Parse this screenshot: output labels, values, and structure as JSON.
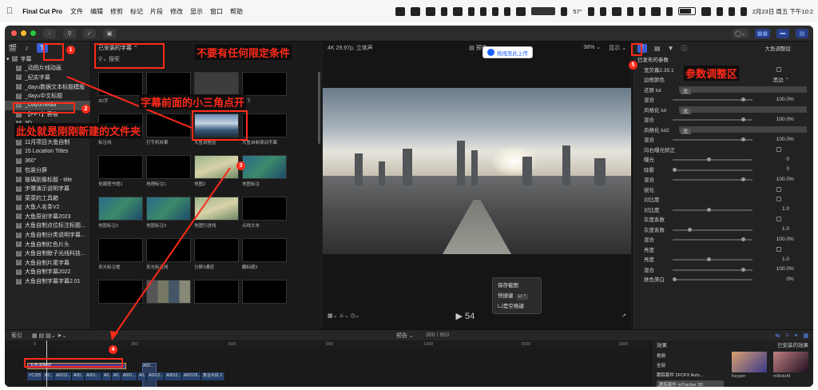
{
  "menubar": {
    "app_name": "Final Cut Pro",
    "items": [
      "文件",
      "编辑",
      "修剪",
      "标记",
      "片段",
      "修改",
      "显示",
      "窗口",
      "帮助"
    ],
    "temperature": "57°",
    "datetime": "2月23日 周五 下午10:2"
  },
  "sidebar": {
    "root_label": "字幕",
    "items": [
      "_动图片线动画",
      "_纪实字幕",
      "_dayu数据文本标题模版",
      "_dayu中文标题",
      "_Dayumedia",
      "【PPT】表格",
      "3D",
      "3D 电影",
      "11月项目大鱼自制",
      "15 Location Titles",
      "360°",
      "包装分屏",
      "玻璃刮像标题 - title",
      "步骤演示说明字幕",
      "菜菜的工具箱",
      "大鱼人名条V2",
      "大鱼原创字幕2023",
      "大鱼自制点位标注标题...",
      "大鱼自制分类说明字幕...",
      "大鱼自制红色片头",
      "大鱼自制鲸子光线科技...",
      "大鱼自制片尾字幕",
      "大鱼自制字幕2022",
      "大鱼自制字幕字幕2.01"
    ]
  },
  "browser": {
    "filter_label": "已安装的字幕 ⌃",
    "search_placeholder": "搜索",
    "cells": [
      {
        "cap": "3D字",
        "style": ""
      },
      {
        "cap": "",
        "style": ""
      },
      {
        "cap": "",
        "style": "lt"
      },
      {
        "cap": "上下",
        "style": ""
      },
      {
        "cap": "标注线",
        "style": ""
      },
      {
        "cap": "打字机效果",
        "style": ""
      },
      {
        "cap": "大鱼调整层",
        "style": "lake"
      },
      {
        "cap": "大鱼自制滚动字幕",
        "style": ""
      },
      {
        "cap": "党建图书馆1",
        "style": ""
      },
      {
        "cap": "地理标注1",
        "style": ""
      },
      {
        "cap": "地图2",
        "style": "aerial"
      },
      {
        "cap": "地图标注",
        "style": "map"
      },
      {
        "cap": "地图标注2",
        "style": "map"
      },
      {
        "cap": "地图标注3",
        "style": "map"
      },
      {
        "cap": "地图行进线",
        "style": "aerial"
      },
      {
        "cap": "点线文本",
        "style": ""
      },
      {
        "cap": "发光标注框",
        "style": ""
      },
      {
        "cap": "发光标注线",
        "style": ""
      },
      {
        "cap": "分屏3通道",
        "style": ""
      },
      {
        "cap": "翻标题2",
        "style": ""
      },
      {
        "cap": "",
        "style": ""
      },
      {
        "cap": "",
        "style": "photo"
      },
      {
        "cap": "",
        "style": ""
      },
      {
        "cap": "",
        "style": ""
      }
    ]
  },
  "viewer": {
    "format": "4K 29.97p, 立体声",
    "preview_label": "预告",
    "zoom": "38% ⌄",
    "display": "显示 ⌄",
    "upload_label": "拖拽至此上传",
    "timecode": "▶ 54",
    "popup": {
      "save_frame": "保存截图",
      "shortcut": "快捷键",
      "shortcut_key": "LI ⌃",
      "lj_note": "LJ是空格键"
    }
  },
  "inspector": {
    "title": "大鱼调整层",
    "rows": [
      {
        "label": "已发布的参数",
        "kind": "hd"
      },
      {
        "label": "宽荧幕2.35:1",
        "kind": "chk"
      },
      {
        "label": "边框颜色",
        "kind": "val",
        "value": "黑边 ⌃"
      },
      {
        "label": "还原 lut",
        "kind": "bar",
        "value": "无"
      },
      {
        "label": "混合",
        "kind": "pct",
        "value": "100.0",
        "pos": 0.9
      },
      {
        "label": "风格化 lut",
        "kind": "bar",
        "value": "无"
      },
      {
        "label": "混合",
        "kind": "pct",
        "value": "100.0",
        "pos": 0.9
      },
      {
        "label": "风格化 lut2",
        "kind": "bar",
        "value": "无"
      },
      {
        "label": "混合",
        "kind": "pct",
        "value": "100.0",
        "pos": 0.9
      },
      {
        "label": "向右曝光矫正",
        "kind": "chk"
      },
      {
        "label": "曝光",
        "kind": "num",
        "value": "0",
        "pos": 0.45
      },
      {
        "label": "除雾",
        "kind": "num",
        "value": "0",
        "pos": 0.0
      },
      {
        "label": "混合",
        "kind": "pct",
        "value": "100.0",
        "pos": 0.9
      },
      {
        "label": "锐化",
        "kind": "chk"
      },
      {
        "label": "对比度",
        "kind": "chk"
      },
      {
        "label": "对比度",
        "kind": "num",
        "value": "1.0",
        "pos": 0.45
      },
      {
        "label": "灰度系数",
        "kind": "chk"
      },
      {
        "label": "灰度系数",
        "kind": "num",
        "value": "1.0",
        "pos": 0.2
      },
      {
        "label": "混合",
        "kind": "pct",
        "value": "100.0",
        "pos": 0.9
      },
      {
        "label": "亮度",
        "kind": "chk"
      },
      {
        "label": "亮度",
        "kind": "num",
        "value": "1.0",
        "pos": 0.45
      },
      {
        "label": "混合",
        "kind": "pct",
        "value": "100.0",
        "pos": 0.9
      },
      {
        "label": "肤色美白",
        "kind": "pct",
        "value": "0",
        "pos": 0.0
      }
    ]
  },
  "timeline": {
    "index_label": "索引",
    "preview_label": "预告 ⌄",
    "timecode": "300 / 903",
    "ruler": [
      "0",
      "300",
      "600",
      "900",
      "1200",
      "1500",
      "1800"
    ],
    "title_clip": "大鱼调整层",
    "blue_clip": "A00...",
    "clips": [
      "YC325",
      "A0...",
      "A0012...",
      "A00...",
      "A001...",
      "A0...",
      "A0...",
      "A001...",
      "A0...",
      "A0012...",
      "A0012...",
      "A00129...",
      "复合片段 2"
    ]
  },
  "effects": {
    "title": "效果",
    "installed": "已安装的效果",
    "list": [
      "视频",
      "全部",
      "跟踪套件 2FCPX Auto...",
      "_跟踪套件 mTracker 3D"
    ],
    "thumbs": [
      "Keyper",
      "mRotoAI"
    ]
  },
  "annotations": {
    "no_filter": "不要有任何限定条件",
    "click_corner": "字幕前面的小三角点开",
    "new_folder": "此处就是刚刚新建的文件夹",
    "params": "参数调整区",
    "badges": [
      "1",
      "2",
      "3",
      "4",
      "5"
    ]
  },
  "colors": {
    "accent": "#3a5dd8",
    "annotation": "#ff2a1a"
  }
}
